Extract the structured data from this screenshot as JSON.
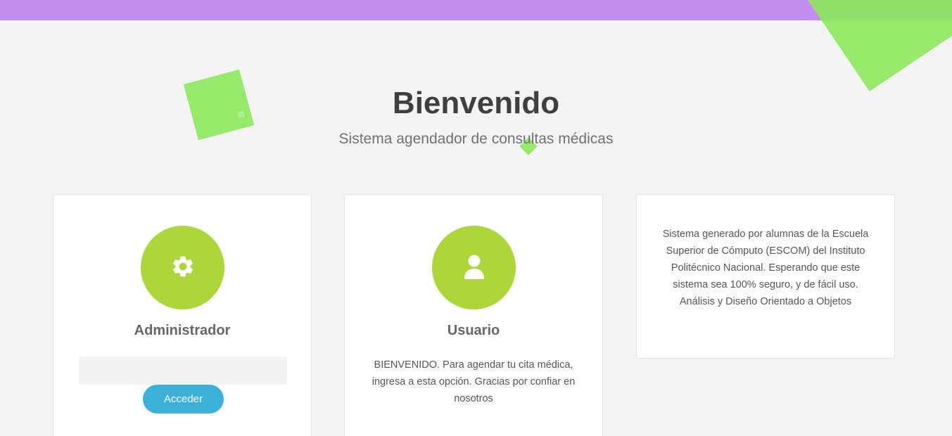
{
  "colors": {
    "topbar": "#c38ff0",
    "deco_green": "#8ee75f",
    "icon_circle": "#acd63a",
    "button": "#3bb0d8"
  },
  "hero": {
    "title": "Bienvenido",
    "subtitle": "Sistema agendador de consultas médicas"
  },
  "admin_card": {
    "icon": "gear-icon",
    "title": "Administrador",
    "input_value": "",
    "button_label": "Acceder"
  },
  "user_card": {
    "icon": "user-icon",
    "title": "Usuario",
    "description": "BIENVENIDO. Para agendar tu cita médica, ingresa a esta opción. Gracias por confiar en nosotros"
  },
  "info_card": {
    "text": "Sistema generado por alumnas de la Escuela Superior de Cómputo (ESCOM) del Instituto Politécnico Nacional. Esperando que este sistema sea 100% seguro, y de fácil uso. Análisis y Diseño Orientado a Objetos"
  }
}
